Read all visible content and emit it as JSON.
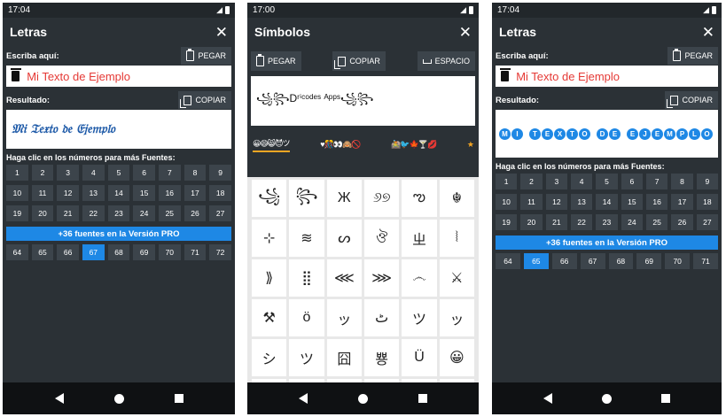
{
  "screens": {
    "letras": {
      "time": "17:04",
      "title": "Letras",
      "write_label": "Escriba aquí:",
      "paste_label": "PEGAR",
      "input_value": "Mi Texto de Ejemplo",
      "result_label": "Resultado:",
      "copy_label": "COPIAR",
      "hint": "Haga clic en los números para más Fuentes:",
      "numbers": [
        "1",
        "2",
        "3",
        "4",
        "5",
        "6",
        "7",
        "8",
        "9",
        "10",
        "11",
        "12",
        "13",
        "14",
        "15",
        "16",
        "17",
        "18",
        "19",
        "20",
        "21",
        "22",
        "23",
        "24",
        "25",
        "26",
        "27"
      ],
      "pro_banner": "+36 fuentes en la Versión PRO",
      "extra_numbers": [
        "64",
        "65",
        "66",
        "67",
        "68",
        "69",
        "70",
        "71",
        "72"
      ]
    },
    "screen1": {
      "result_text": "𝔐𝔦 𝔗𝔢𝔵𝔱𝔬 𝔡𝔢 𝔈𝔧𝔢𝔪𝔭𝔩𝔬",
      "selected": "67"
    },
    "screen3": {
      "time": "17:04",
      "result_letters": [
        "M",
        "I",
        " ",
        "T",
        "E",
        "X",
        "T",
        "O",
        " ",
        "D",
        "E",
        " ",
        "E",
        "J",
        "E",
        "M",
        "P",
        "L",
        "O"
      ],
      "selected": "65"
    },
    "simbolos": {
      "time": "17:00",
      "title": "Símbolos",
      "paste_label": "PEGAR",
      "copy_label": "COPIAR",
      "space_label": "ESPACIO",
      "preview": "꧁꧂Dʳⁱᶜᵒᵈᵉˢ ᴬᵖᵖˢ꧁꧂",
      "categories": [
        "😀😄😸😈ツ",
        "♥🎊👀🙈🚫",
        "🚵🐦🍁🍸💋",
        "★"
      ],
      "symbols": [
        "꧁",
        "꧂",
        "Ж",
        "୬୭",
        "ఌ",
        "☬",
        "⊹",
        "≋",
        "ᔕ",
        "ঔ",
        "ㄓ",
        "⦚",
        "⟫",
        "⣿",
        "⋘",
        "⋙",
        "෴",
        "⚔",
        "⚒",
        "ö",
        "ッ",
        "ٹ",
        "ツ",
        "ッ",
        "シ",
        "ツ",
        "囧",
        "뿅",
        "Ü",
        "😀",
        "😁",
        "😂",
        "🤣",
        "😃",
        "😄",
        "😅"
      ]
    }
  },
  "close_icon": "✕",
  "icons": {
    "clipboard": "clipboard-icon",
    "copy": "copy-icon",
    "trash": "trash-icon"
  },
  "colors": {
    "accent": "#1e88e5",
    "bg": "#2b3136",
    "button": "#3c444b",
    "input_text": "#e53935"
  }
}
